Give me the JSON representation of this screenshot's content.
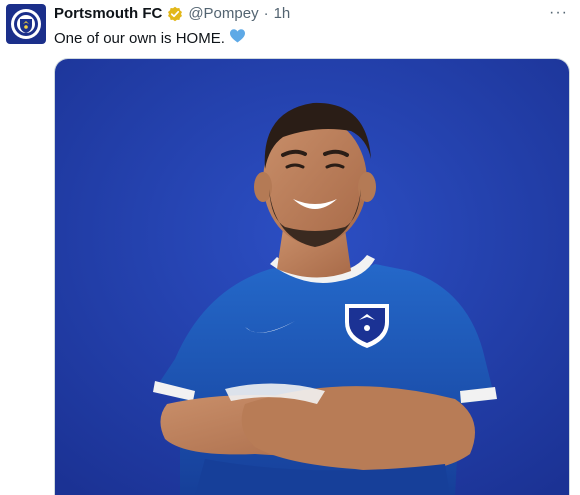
{
  "tweet": {
    "account_name": "Portsmouth FC",
    "handle": "@Pompey",
    "separator": "·",
    "time": "1h",
    "text": "One of our own is HOME.",
    "emoji": "blue-heart-icon",
    "verified_badge": "gold-verified-icon",
    "more_label": "···"
  },
  "colors": {
    "brand": "#1b2f8a",
    "verified_gold": "#e2b719",
    "heart": "#5ea9e6",
    "photo_background": "#2442b4",
    "shirt": "#1d56b8"
  }
}
